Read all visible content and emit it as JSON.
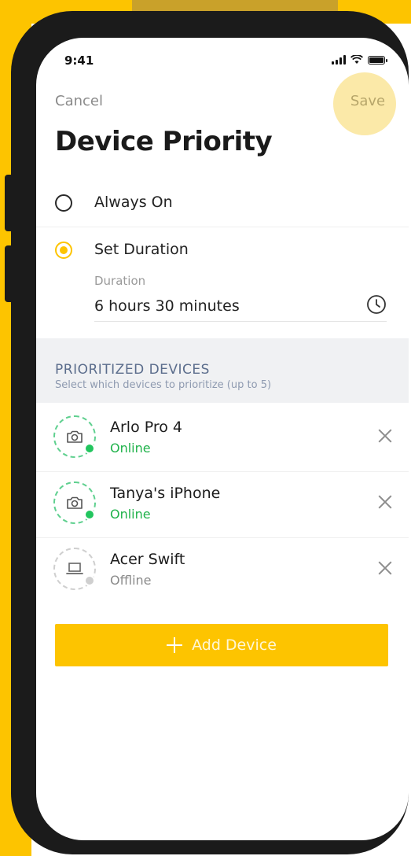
{
  "status_bar": {
    "time": "9:41"
  },
  "header": {
    "cancel_label": "Cancel",
    "save_label": "Save",
    "title": "Device Priority"
  },
  "options": [
    {
      "label": "Always On",
      "selected": false
    },
    {
      "label": "Set Duration",
      "selected": true
    }
  ],
  "duration": {
    "label": "Duration",
    "value": "6 hours 30 minutes"
  },
  "prioritized": {
    "title": "PRIORITIZED DEVICES",
    "subtitle": "Select which devices to prioritize (up to 5)"
  },
  "devices": [
    {
      "name": "Arlo Pro 4",
      "status": "Online",
      "icon": "camera-icon"
    },
    {
      "name": "Tanya's iPhone",
      "status": "Online",
      "icon": "camera-icon"
    },
    {
      "name": "Acer Swift",
      "status": "Offline",
      "icon": "laptop-icon"
    }
  ],
  "add_button": {
    "label": "Add Device"
  },
  "colors": {
    "accent": "#fdc400",
    "online": "#1fb24a",
    "section_bg": "#f0f1f3"
  }
}
